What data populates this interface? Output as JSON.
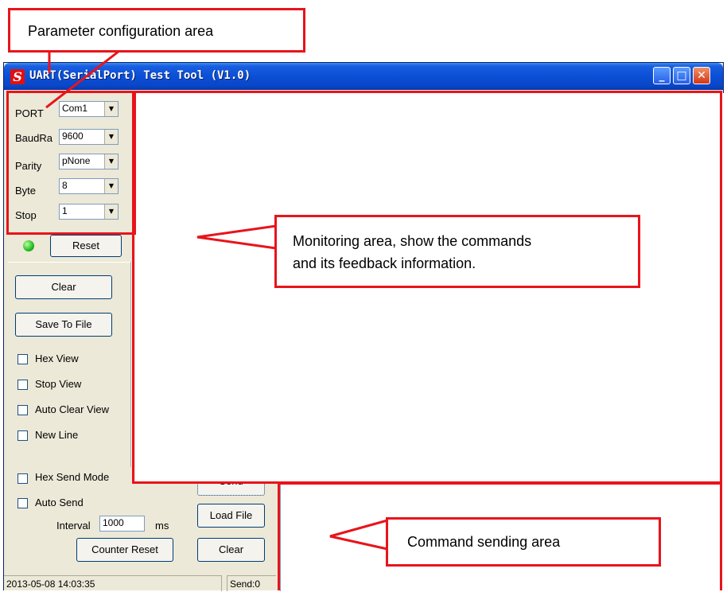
{
  "window": {
    "title": "UART(SerialPort) Test Tool (V1.0)",
    "logo_glyph": "S",
    "controls": {
      "minimize": "_",
      "maximize": "□",
      "close": "✕"
    }
  },
  "params": {
    "port": {
      "label": "PORT",
      "value": "Com1"
    },
    "baud": {
      "label": "BaudRa",
      "value": "9600"
    },
    "parity": {
      "label": "Parity",
      "value": "pNone"
    },
    "byte": {
      "label": "Byte",
      "value": "8"
    },
    "stop": {
      "label": "Stop",
      "value": "1"
    }
  },
  "status_led_color": "#22bb22",
  "buttons": {
    "reset": "Reset",
    "clear": "Clear",
    "save_to_file": "Save To File",
    "send": "Send",
    "load_file": "Load File",
    "clear_send": "Clear",
    "counter_reset": "Counter Reset"
  },
  "checkboxes": {
    "hex_view": "Hex View",
    "stop_view": "Stop View",
    "auto_clear_view": "Auto Clear View",
    "new_line": "New Line",
    "hex_send_mode": "Hex Send Mode",
    "auto_send": "Auto Send"
  },
  "interval": {
    "label": "Interval",
    "value": "1000",
    "unit": "ms"
  },
  "statusbar": {
    "datetime": "2013-05-08 14:03:35",
    "send_count": "Send:0"
  },
  "annotations": {
    "param_area": "Parameter configuration area",
    "monitor_line1": "Monitoring area, show the commands",
    "monitor_line2": "and its feedback information.",
    "command_area": "Command sending area"
  },
  "colors": {
    "annotation_red": "#e8141b",
    "titlebar_blue": "#0a4fd6",
    "window_bg": "#ece9d8"
  }
}
